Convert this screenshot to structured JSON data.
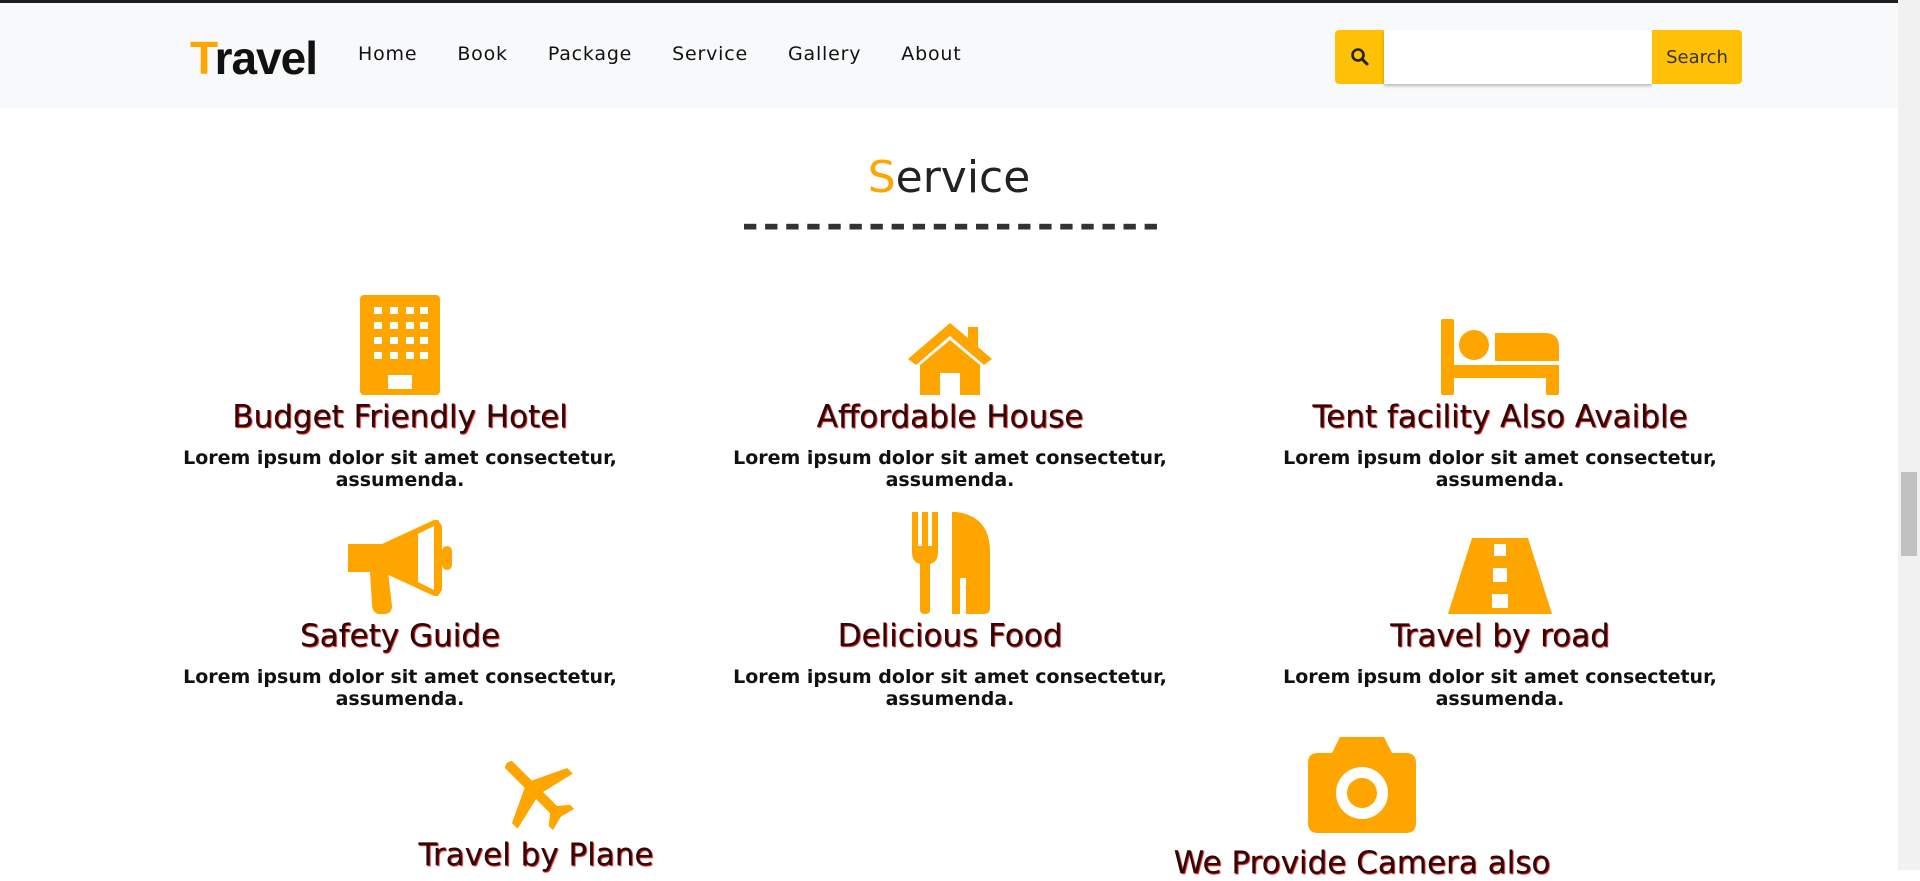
{
  "header": {
    "brand_first": "T",
    "brand_rest": "ravel",
    "nav": [
      "Home",
      "Book",
      "Package",
      "Service",
      "Gallery",
      "About"
    ],
    "search_value": "",
    "search_button": "Search"
  },
  "section": {
    "title_first": "S",
    "title_rest": "ervice",
    "divider": "--------------------"
  },
  "services": [
    {
      "title": "Budget Friendly Hotel",
      "text": "Lorem ipsum dolor sit amet consectetur, assumenda.",
      "icon": "hotel-icon"
    },
    {
      "title": "Affordable House",
      "text": "Lorem ipsum dolor sit amet consectetur, assumenda.",
      "icon": "house-icon"
    },
    {
      "title": "Tent facility Also Avaible",
      "text": "Lorem ipsum dolor sit amet consectetur, assumenda.",
      "icon": "bed-icon"
    },
    {
      "title": "Safety Guide",
      "text": "Lorem ipsum dolor sit amet consectetur, assumenda.",
      "icon": "megaphone-icon"
    },
    {
      "title": "Delicious Food",
      "text": "Lorem ipsum dolor sit amet consectetur, assumenda.",
      "icon": "utensils-icon"
    },
    {
      "title": "Travel by road",
      "text": "Lorem ipsum dolor sit amet consectetur, assumenda.",
      "icon": "road-icon"
    },
    {
      "title": "Travel by Plane",
      "icon": "plane-icon"
    },
    {
      "title": "We Provide Camera also",
      "icon": "camera-icon"
    }
  ],
  "colors": {
    "accent": "#ffa500",
    "button": "#ffc107",
    "nav_bg": "#f8f9fa"
  }
}
